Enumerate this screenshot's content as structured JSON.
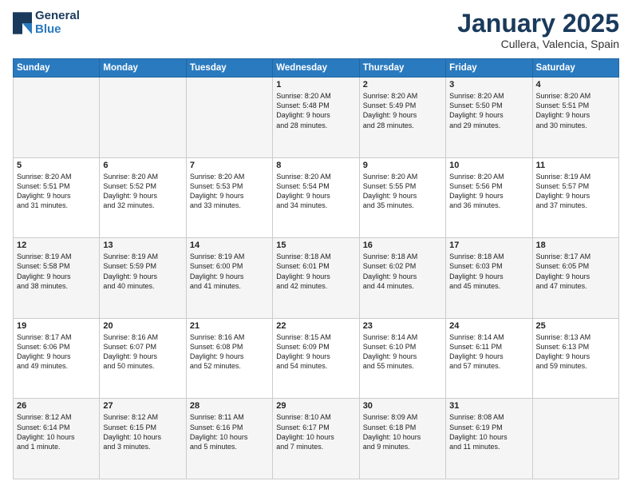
{
  "header": {
    "logo_line1": "General",
    "logo_line2": "Blue",
    "month": "January 2025",
    "location": "Cullera, Valencia, Spain"
  },
  "weekdays": [
    "Sunday",
    "Monday",
    "Tuesday",
    "Wednesday",
    "Thursday",
    "Friday",
    "Saturday"
  ],
  "weeks": [
    [
      {
        "day": "",
        "info": ""
      },
      {
        "day": "",
        "info": ""
      },
      {
        "day": "",
        "info": ""
      },
      {
        "day": "1",
        "info": "Sunrise: 8:20 AM\nSunset: 5:48 PM\nDaylight: 9 hours\nand 28 minutes."
      },
      {
        "day": "2",
        "info": "Sunrise: 8:20 AM\nSunset: 5:49 PM\nDaylight: 9 hours\nand 28 minutes."
      },
      {
        "day": "3",
        "info": "Sunrise: 8:20 AM\nSunset: 5:50 PM\nDaylight: 9 hours\nand 29 minutes."
      },
      {
        "day": "4",
        "info": "Sunrise: 8:20 AM\nSunset: 5:51 PM\nDaylight: 9 hours\nand 30 minutes."
      }
    ],
    [
      {
        "day": "5",
        "info": "Sunrise: 8:20 AM\nSunset: 5:51 PM\nDaylight: 9 hours\nand 31 minutes."
      },
      {
        "day": "6",
        "info": "Sunrise: 8:20 AM\nSunset: 5:52 PM\nDaylight: 9 hours\nand 32 minutes."
      },
      {
        "day": "7",
        "info": "Sunrise: 8:20 AM\nSunset: 5:53 PM\nDaylight: 9 hours\nand 33 minutes."
      },
      {
        "day": "8",
        "info": "Sunrise: 8:20 AM\nSunset: 5:54 PM\nDaylight: 9 hours\nand 34 minutes."
      },
      {
        "day": "9",
        "info": "Sunrise: 8:20 AM\nSunset: 5:55 PM\nDaylight: 9 hours\nand 35 minutes."
      },
      {
        "day": "10",
        "info": "Sunrise: 8:20 AM\nSunset: 5:56 PM\nDaylight: 9 hours\nand 36 minutes."
      },
      {
        "day": "11",
        "info": "Sunrise: 8:19 AM\nSunset: 5:57 PM\nDaylight: 9 hours\nand 37 minutes."
      }
    ],
    [
      {
        "day": "12",
        "info": "Sunrise: 8:19 AM\nSunset: 5:58 PM\nDaylight: 9 hours\nand 38 minutes."
      },
      {
        "day": "13",
        "info": "Sunrise: 8:19 AM\nSunset: 5:59 PM\nDaylight: 9 hours\nand 40 minutes."
      },
      {
        "day": "14",
        "info": "Sunrise: 8:19 AM\nSunset: 6:00 PM\nDaylight: 9 hours\nand 41 minutes."
      },
      {
        "day": "15",
        "info": "Sunrise: 8:18 AM\nSunset: 6:01 PM\nDaylight: 9 hours\nand 42 minutes."
      },
      {
        "day": "16",
        "info": "Sunrise: 8:18 AM\nSunset: 6:02 PM\nDaylight: 9 hours\nand 44 minutes."
      },
      {
        "day": "17",
        "info": "Sunrise: 8:18 AM\nSunset: 6:03 PM\nDaylight: 9 hours\nand 45 minutes."
      },
      {
        "day": "18",
        "info": "Sunrise: 8:17 AM\nSunset: 6:05 PM\nDaylight: 9 hours\nand 47 minutes."
      }
    ],
    [
      {
        "day": "19",
        "info": "Sunrise: 8:17 AM\nSunset: 6:06 PM\nDaylight: 9 hours\nand 49 minutes."
      },
      {
        "day": "20",
        "info": "Sunrise: 8:16 AM\nSunset: 6:07 PM\nDaylight: 9 hours\nand 50 minutes."
      },
      {
        "day": "21",
        "info": "Sunrise: 8:16 AM\nSunset: 6:08 PM\nDaylight: 9 hours\nand 52 minutes."
      },
      {
        "day": "22",
        "info": "Sunrise: 8:15 AM\nSunset: 6:09 PM\nDaylight: 9 hours\nand 54 minutes."
      },
      {
        "day": "23",
        "info": "Sunrise: 8:14 AM\nSunset: 6:10 PM\nDaylight: 9 hours\nand 55 minutes."
      },
      {
        "day": "24",
        "info": "Sunrise: 8:14 AM\nSunset: 6:11 PM\nDaylight: 9 hours\nand 57 minutes."
      },
      {
        "day": "25",
        "info": "Sunrise: 8:13 AM\nSunset: 6:13 PM\nDaylight: 9 hours\nand 59 minutes."
      }
    ],
    [
      {
        "day": "26",
        "info": "Sunrise: 8:12 AM\nSunset: 6:14 PM\nDaylight: 10 hours\nand 1 minute."
      },
      {
        "day": "27",
        "info": "Sunrise: 8:12 AM\nSunset: 6:15 PM\nDaylight: 10 hours\nand 3 minutes."
      },
      {
        "day": "28",
        "info": "Sunrise: 8:11 AM\nSunset: 6:16 PM\nDaylight: 10 hours\nand 5 minutes."
      },
      {
        "day": "29",
        "info": "Sunrise: 8:10 AM\nSunset: 6:17 PM\nDaylight: 10 hours\nand 7 minutes."
      },
      {
        "day": "30",
        "info": "Sunrise: 8:09 AM\nSunset: 6:18 PM\nDaylight: 10 hours\nand 9 minutes."
      },
      {
        "day": "31",
        "info": "Sunrise: 8:08 AM\nSunset: 6:19 PM\nDaylight: 10 hours\nand 11 minutes."
      },
      {
        "day": "",
        "info": ""
      }
    ]
  ]
}
